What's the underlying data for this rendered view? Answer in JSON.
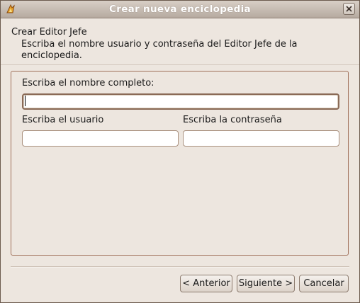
{
  "window": {
    "title": "Crear nueva enciclopedia"
  },
  "header": {
    "title": "Crear Editor Jefe",
    "description": "Escriba el nombre usuario y contraseña del Editor Jefe de la enciclopedia."
  },
  "form": {
    "full_name_label": "Escriba el nombre completo:",
    "full_name_value": "",
    "username_label": "Escriba el usuario",
    "username_value": "",
    "password_label": "Escriba la contraseña",
    "password_value": ""
  },
  "buttons": {
    "previous": "< Anterior",
    "next": "Siguiente >",
    "cancel": "Cancelar"
  },
  "colors": {
    "frame_border": "#a0705a",
    "window_bg": "#ede6df"
  },
  "icons": {
    "app": "app-icon",
    "close": "close-icon"
  }
}
